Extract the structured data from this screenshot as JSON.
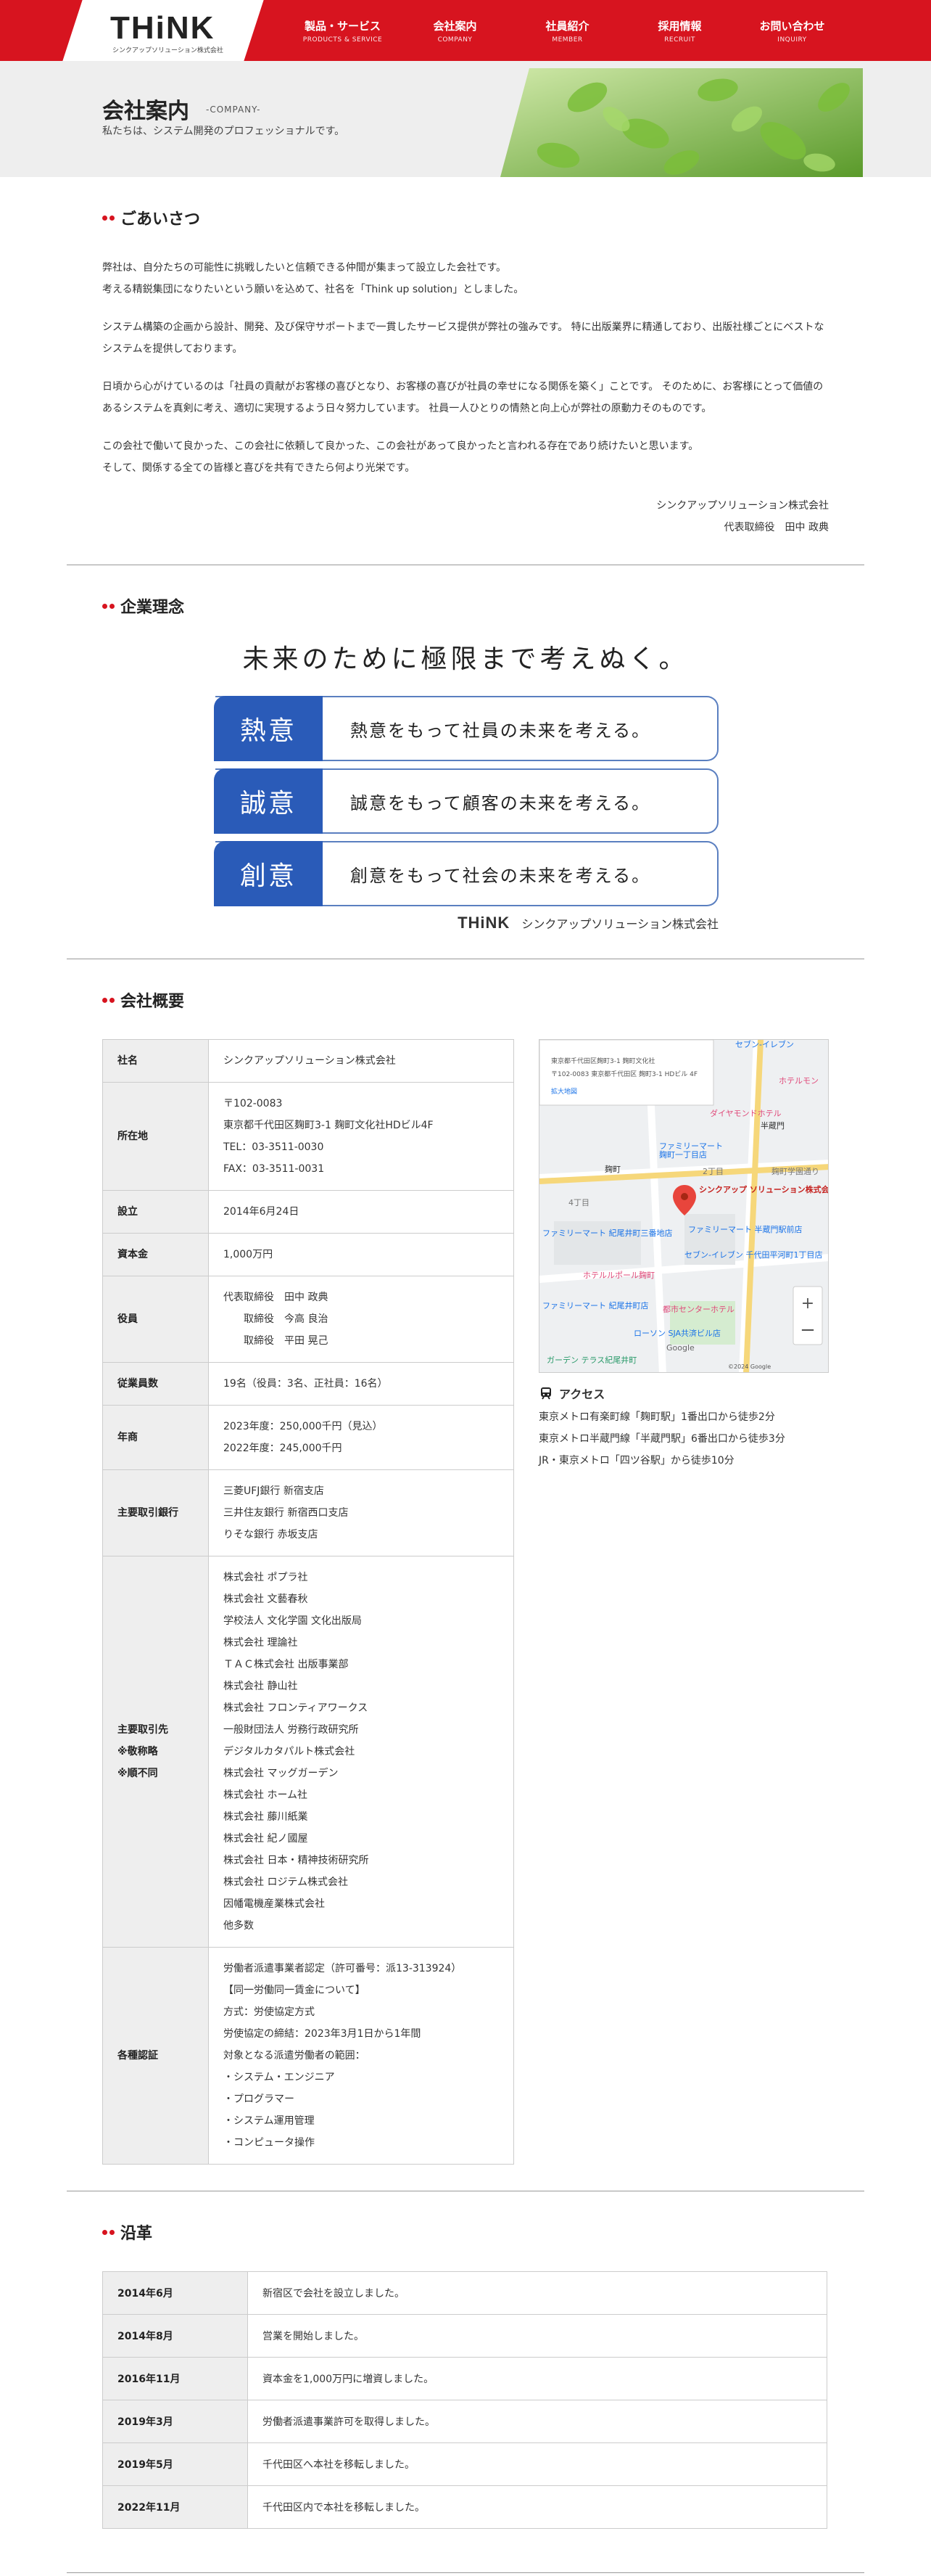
{
  "header": {
    "logo": "THiNK",
    "logo_sub": "シンクアップソリューション株式会社",
    "nav": [
      {
        "ja": "製品・サービス",
        "en": "PRODUCTS & SERVICE"
      },
      {
        "ja": "会社案内",
        "en": "COMPANY"
      },
      {
        "ja": "社員紹介",
        "en": "MEMBER"
      },
      {
        "ja": "採用情報",
        "en": "RECRUIT"
      },
      {
        "ja": "お問い合わせ",
        "en": "INQUIRY"
      }
    ]
  },
  "hero": {
    "title": "会社案内",
    "title_en": "-COMPANY-",
    "subtitle": "私たちは、システム開発のプロフェッショナルです。"
  },
  "greeting": {
    "heading": "ごあいさつ",
    "p1": "弊社は、自分たちの可能性に挑戦したいと信頼できる仲間が集まって設立した会社です。",
    "p1b": "考える精鋭集団になりたいという願いを込めて、社名を「Think up solution」としました。",
    "p2": "システム構築の企画から設計、開発、及び保守サポートまで一貫したサービス提供が弊社の強みです。 特に出版業界に精通しており、出版社様ごとにベストなシステムを提供しております。",
    "p3": "日頃から心がけているのは「社員の貢献がお客様の喜びとなり、お客様の喜びが社員の幸せになる関係を築く」ことです。 そのために、お客様にとって価値のあるシステムを真剣に考え、適切に実現するよう日々努力しています。 社員一人ひとりの情熱と向上心が弊社の原動力そのものです。",
    "p4": "この会社で働いて良かった、この会社に依頼して良かった、この会社があって良かったと言われる存在であり続けたいと思います。",
    "p4b": "そして、関係する全ての皆様と喜びを共有できたら何より光栄です。",
    "company": "シンクアップソリューション株式会社",
    "ceo": "代表取締役　田中 政典"
  },
  "philosophy": {
    "heading": "企業理念",
    "motto": "未来のために極限まで考えぬく。",
    "rows": [
      {
        "badge": "熱意",
        "text": "熱意をもって社員の未来を考える。"
      },
      {
        "badge": "誠意",
        "text": "誠意をもって顧客の未来を考える。"
      },
      {
        "badge": "創意",
        "text": "創意をもって社会の未来を考える。"
      }
    ],
    "sign_logo": "THiNK",
    "sign_name": "シンクアップソリューション株式会社"
  },
  "profile": {
    "heading": "会社概要",
    "rows": [
      {
        "label": "社名",
        "lines": [
          "シンクアップソリューション株式会社"
        ]
      },
      {
        "label": "所在地",
        "lines": [
          "〒102-0083",
          "東京都千代田区麹町3-1 麹町文化社HDビル4F",
          "TEL：03-3511-0030",
          "FAX：03-3511-0031"
        ]
      },
      {
        "label": "設立",
        "lines": [
          "2014年6月24日"
        ]
      },
      {
        "label": "資本金",
        "lines": [
          "1,000万円"
        ]
      },
      {
        "label": "役員",
        "lines": [
          "代表取締役　田中 政典",
          "　　取締役　今高 良治",
          "　　取締役　平田 晃己"
        ]
      },
      {
        "label": "従業員数",
        "lines": [
          "19名（役員：3名、正社員：16名）"
        ]
      },
      {
        "label": "年商",
        "lines": [
          "2023年度：250,000千円（見込）",
          "2022年度：245,000千円"
        ]
      },
      {
        "label": "主要取引銀行",
        "lines": [
          "三菱UFJ銀行 新宿支店",
          "三井住友銀行 新宿西口支店",
          "りそな銀行 赤坂支店"
        ]
      },
      {
        "label": "主要取引先\n※敬称略\n※順不同",
        "lines": [
          "株式会社 ポプラ社",
          "株式会社 文藝春秋",
          "学校法人 文化学園 文化出版局",
          "株式会社 理論社",
          "ＴＡＣ株式会社 出版事業部",
          "株式会社 静山社",
          "株式会社 フロンティアワークス",
          "一般財団法人 労務行政研究所",
          "デジタルカタパルト株式会社",
          "株式会社 マッグガーデン",
          "株式会社 ホーム社",
          "株式会社 藤川紙業",
          "株式会社 紀ノ國屋",
          "株式会社 日本・精神技術研究所",
          "株式会社 ロジテム株式会社",
          "因幡電機産業株式会社",
          "他多数"
        ]
      },
      {
        "label": "各種認証",
        "lines": [
          "労働者派遣事業者認定（許可番号：派13-313924）",
          "【同一労働同一賃金について】",
          "方式：労使協定方式",
          "労使協定の締結：2023年3月1日から1年間",
          "対象となる派遣労働者の範囲：",
          "・システム・エンジニア",
          "・プログラマー",
          "・システム運用管理",
          "・コンピュータ操作"
        ]
      }
    ],
    "map": {
      "info_line1": "東京都千代田区麹町3-1 麹町文化社",
      "info_line2": "〒102-0083 東京都千代田区 麹町3-1 HDビル 4F",
      "info_link": "拡大地図",
      "marker_label": "シンクアップ ソリューション株式会社",
      "copyright": "©2024 Google",
      "places": [
        "セブン-イレブン",
        "ホテルモン",
        "ダイヤモンドホテル",
        "半蔵門",
        "ファミリーマート",
        "麹町一丁目店",
        "2丁目",
        "麹町",
        "4丁目",
        "麹町学園通り",
        "ファミリーマート 紀尾井町三番地店",
        "ファミリーマート 半蔵門駅前店",
        "セブン-イレブン 千代田平河町1丁目店",
        "ホテルルポール麹町",
        "都市センターホテル",
        "ファミリーマート 紀尾井町店",
        "ローソン SJA共済ビル店",
        "ガーデン テラス紀尾井町",
        "Google"
      ]
    },
    "access_title": "アクセス",
    "access": [
      "東京メトロ有楽町線「麹町駅」1番出口から徒歩2分",
      "東京メトロ半蔵門線「半蔵門駅」6番出口から徒歩3分",
      "JR・東京メトロ「四ツ谷駅」から徒歩10分"
    ]
  },
  "history": {
    "heading": "沿革",
    "rows": [
      {
        "date": "2014年6月",
        "event": "新宿区で会社を設立しました。"
      },
      {
        "date": "2014年8月",
        "event": "営業を開始しました。"
      },
      {
        "date": "2016年11月",
        "event": "資本金を1,000万円に増資しました。"
      },
      {
        "date": "2019年3月",
        "event": "労働者派遣事業許可を取得しました。"
      },
      {
        "date": "2019年5月",
        "event": "千代田区へ本社を移転しました。"
      },
      {
        "date": "2022年11月",
        "event": "千代田区内で本社を移転しました。"
      }
    ]
  },
  "colors": {
    "brand_red": "#d7141f",
    "philosophy_blue": "#2a5bb8"
  }
}
